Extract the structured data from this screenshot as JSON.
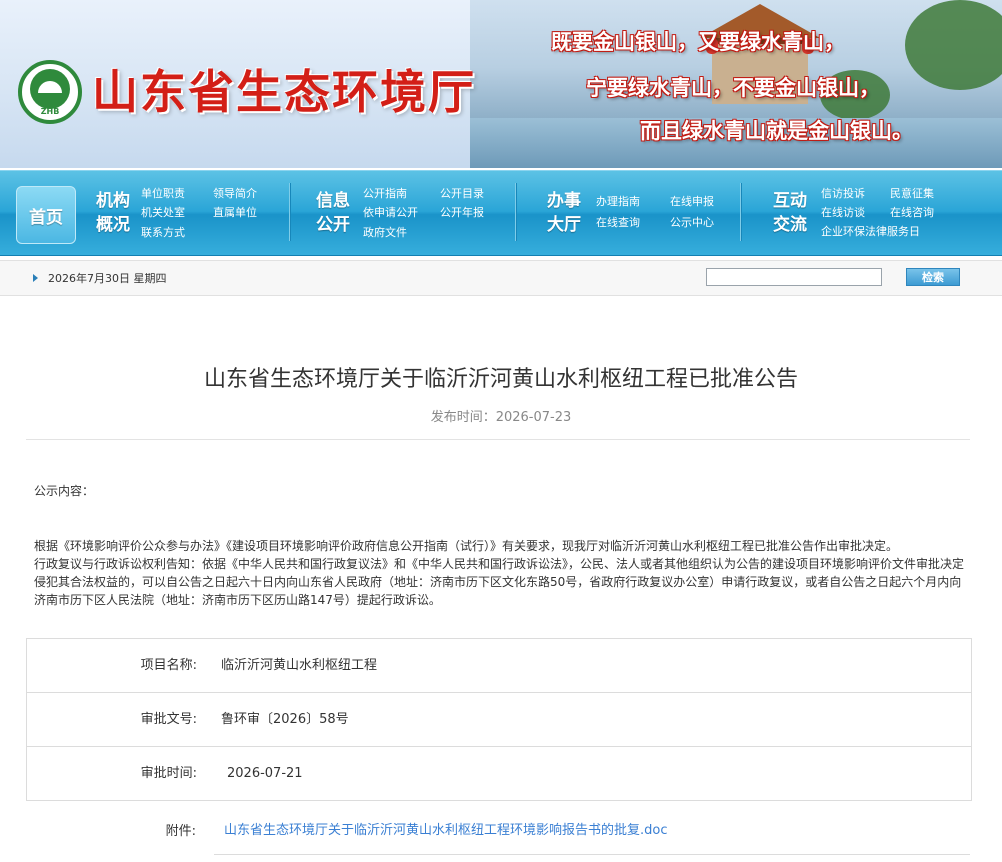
{
  "banner": {
    "site_title": "山东省生态环境厅",
    "logo_text": "ZHB",
    "slogans": [
      "既要金山银山，又要绿水青山，",
      "宁要绿水青山，不要金山银山，",
      "而且绿水青山就是金山银山。"
    ]
  },
  "nav": {
    "home": "首页",
    "groups": [
      {
        "title": [
          "机构",
          "概况"
        ],
        "links": [
          "单位职责",
          "领导简介",
          "机关处室",
          "直属单位",
          "联系方式"
        ]
      },
      {
        "title": [
          "信息",
          "公开"
        ],
        "links": [
          "公开指南",
          "公开目录",
          "依申请公开",
          "公开年报",
          "政府文件"
        ]
      },
      {
        "title": [
          "办事",
          "大厅"
        ],
        "links": [
          "办理指南",
          "在线申报",
          "在线查询",
          "公示中心"
        ]
      },
      {
        "title": [
          "互动",
          "交流"
        ],
        "links": [
          "信访投诉",
          "民意征集",
          "在线访谈",
          "在线咨询",
          "企业环保法律服务日"
        ]
      }
    ]
  },
  "topbar": {
    "date": "2026年7月30日 星期四",
    "search_placeholder": "",
    "search_button": "检索"
  },
  "article": {
    "title": "山东省生态环境厅关于临沂沂河黄山水利枢纽工程已批准公告",
    "publish_time": "发布时间：2026-07-23",
    "notice_label": "公示内容：",
    "paragraphs": [
      "根据《环境影响评价公众参与办法》《建设项目环境影响评价政府信息公开指南（试行）》有关要求，现我厅对临沂沂河黄山水利枢纽工程已批准公告作出审批决定。",
      "行政复议与行政诉讼权利告知：依据《中华人民共和国行政复议法》和《中华人民共和国行政诉讼法》，公民、法人或者其他组织认为公告的建设项目环境影响评价文件审批决定侵犯其合法权益的，可以自公告之日起六十日内向山东省人民政府（地址：济南市历下区文化东路50号，省政府行政复议办公室）申请行政复议，或者自公告之日起六个月内向济南市历下区人民法院（地址：济南市历下区历山路147号）提起行政诉讼。"
    ]
  },
  "info": {
    "rows": [
      {
        "label": "项目名称:",
        "value": "临沂沂河黄山水利枢纽工程"
      },
      {
        "label": "审批文号:",
        "value": "鲁环审〔2026〕58号"
      },
      {
        "label": "审批时间:",
        "value": "2026-07-21"
      }
    ],
    "attachment_label": "附件:",
    "attachment_name": "山东省生态环境厅关于临沂沂河黄山水利枢纽工程环境影响报告书的批复.doc"
  }
}
